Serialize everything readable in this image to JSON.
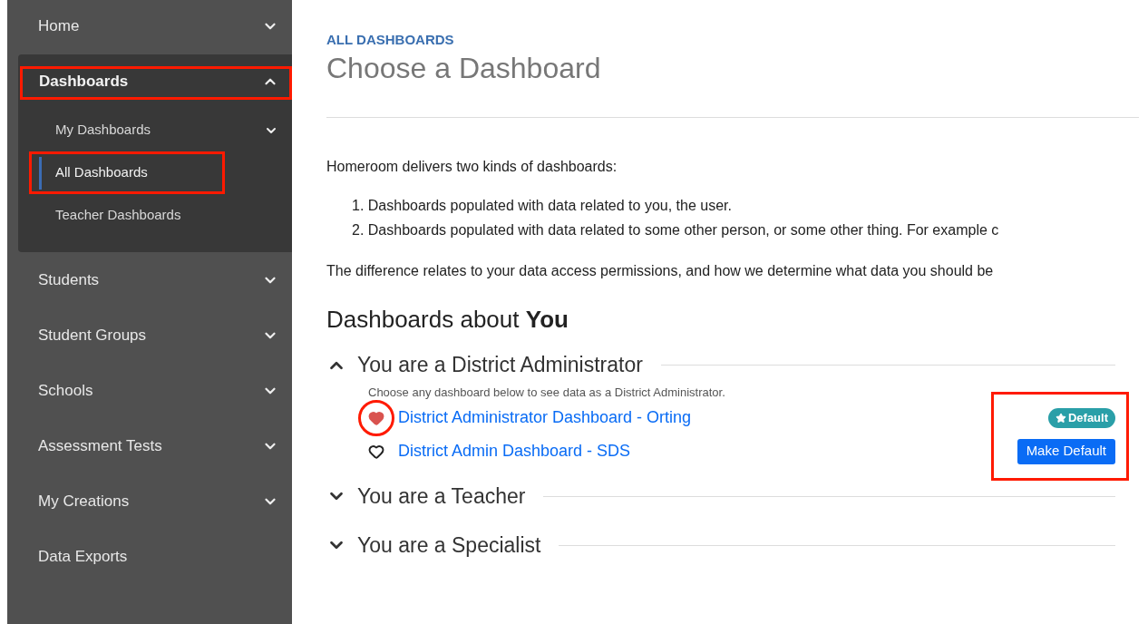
{
  "sidebar": {
    "items": [
      {
        "label": "Home",
        "kind": "group",
        "expanded": false,
        "highlighted": false
      },
      {
        "label": "Dashboards",
        "kind": "group",
        "expanded": true,
        "highlighted": true,
        "children": [
          {
            "label": "My Dashboards",
            "kind": "group",
            "expanded": false,
            "selected": false,
            "highlighted": false
          },
          {
            "label": "All Dashboards",
            "kind": "link",
            "selected": true,
            "highlighted": true
          },
          {
            "label": "Teacher Dashboards",
            "kind": "link",
            "selected": false,
            "highlighted": false
          }
        ]
      },
      {
        "label": "Students",
        "kind": "group",
        "expanded": false,
        "highlighted": false
      },
      {
        "label": "Student Groups",
        "kind": "group",
        "expanded": false,
        "highlighted": false
      },
      {
        "label": "Schools",
        "kind": "group",
        "expanded": false,
        "highlighted": false
      },
      {
        "label": "Assessment Tests",
        "kind": "group",
        "expanded": false,
        "highlighted": false
      },
      {
        "label": "My Creations",
        "kind": "group",
        "expanded": false,
        "highlighted": false
      },
      {
        "label": "Data Exports",
        "kind": "link",
        "highlighted": false
      }
    ]
  },
  "main": {
    "eyebrow": "ALL DASHBOARDS",
    "title": "Choose a Dashboard",
    "intro": "Homeroom delivers two kinds of dashboards:",
    "list": [
      {
        "number": "1.",
        "text": "Dashboards populated with data related to you, the user."
      },
      {
        "number": "2.",
        "text": "Dashboards populated with data related to some other person, or some other thing. For example c"
      }
    ],
    "note": "The difference relates to your data access permissions, and how we determine what data you should be",
    "heading": "Dashboards about **You**",
    "sections": [
      {
        "title": "You are a District Administrator",
        "expanded": true,
        "description": "Choose any dashboard below to see data as a District Administrator.",
        "actions_highlighted": true,
        "dashboards": [
          {
            "name": "District Administrator Dashboard - Orting",
            "favorite": true,
            "favorite_highlighted": true,
            "default": true,
            "action": "Default"
          },
          {
            "name": "District Admin Dashboard - SDS",
            "favorite": false,
            "favorite_highlighted": false,
            "default": false,
            "action": "Make Default"
          }
        ]
      },
      {
        "title": "You are a Teacher",
        "expanded": false
      },
      {
        "title": "You are a Specialist",
        "expanded": false
      }
    ]
  }
}
